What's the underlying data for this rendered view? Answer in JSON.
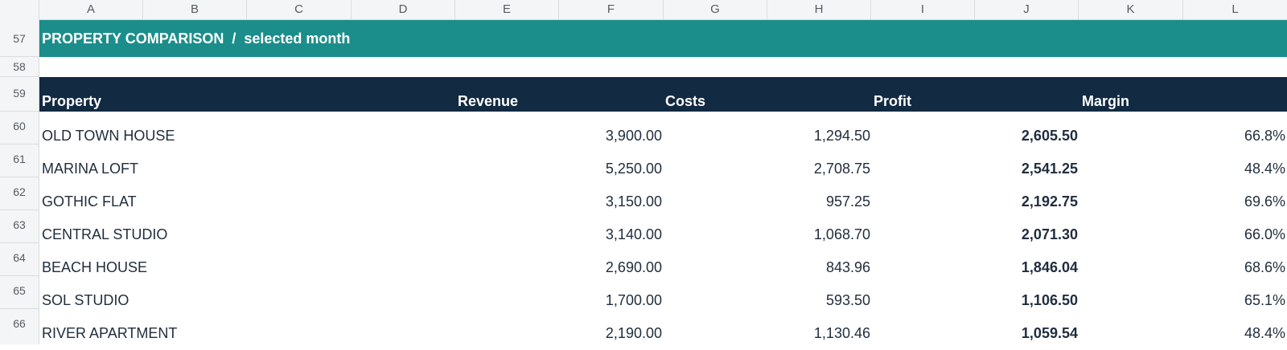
{
  "columns": [
    "A",
    "B",
    "C",
    "D",
    "E",
    "F",
    "G",
    "H",
    "I",
    "J",
    "K",
    "L"
  ],
  "row_numbers": [
    "57",
    "58",
    "59",
    "60",
    "61",
    "62",
    "63",
    "64",
    "65",
    "66"
  ],
  "banner": {
    "title": "PROPERTY COMPARISON  /  selected month"
  },
  "table": {
    "headers": {
      "property": "Property",
      "revenue": "Revenue",
      "costs": "Costs",
      "profit": "Profit",
      "margin": "Margin"
    },
    "rows": [
      {
        "property": "OLD TOWN HOUSE",
        "revenue": "3,900.00",
        "costs": "1,294.50",
        "profit": "2,605.50",
        "margin": "66.8%"
      },
      {
        "property": "MARINA LOFT",
        "revenue": "5,250.00",
        "costs": "2,708.75",
        "profit": "2,541.25",
        "margin": "48.4%"
      },
      {
        "property": "GOTHIC FLAT",
        "revenue": "3,150.00",
        "costs": "957.25",
        "profit": "2,192.75",
        "margin": "69.6%"
      },
      {
        "property": "CENTRAL STUDIO",
        "revenue": "3,140.00",
        "costs": "1,068.70",
        "profit": "2,071.30",
        "margin": "66.0%"
      },
      {
        "property": "BEACH HOUSE",
        "revenue": "2,690.00",
        "costs": "843.96",
        "profit": "1,846.04",
        "margin": "68.6%"
      },
      {
        "property": "SOL STUDIO",
        "revenue": "1,700.00",
        "costs": "593.50",
        "profit": "1,106.50",
        "margin": "65.1%"
      },
      {
        "property": "RIVER APARTMENT",
        "revenue": "2,190.00",
        "costs": "1,130.46",
        "profit": "1,059.54",
        "margin": "48.4%"
      }
    ]
  },
  "colors": {
    "banner_bg": "#1b8e8b",
    "header_bg": "#122a42",
    "header_text": "#ffffff",
    "body_text": "#1f2d3d"
  }
}
